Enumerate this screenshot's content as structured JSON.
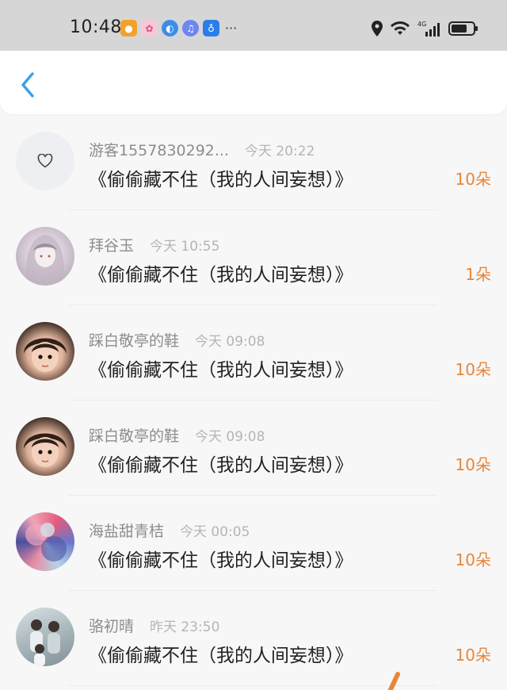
{
  "status_bar": {
    "time": "10:48",
    "more": "···",
    "notification_icons": [
      "camera-app-icon",
      "gift-app-icon",
      "browser-app-icon",
      "music-app-icon",
      "bulb-app-icon"
    ],
    "network_label": "4G"
  },
  "header": {
    "back_icon": "chevron-left-icon"
  },
  "colors": {
    "accent": "#e8863a",
    "back": "#3aa0e8",
    "name": "#8d8d8d",
    "time": "#b5b5b5"
  },
  "items": [
    {
      "name": "游客1557830292...",
      "time": "今天 20:22",
      "title": "《偷偷藏不住（我的人间妄想）》",
      "count": "10朵",
      "avatar": "heart-icon"
    },
    {
      "name": "拜谷玉",
      "time": "今天 10:55",
      "title": "《偷偷藏不住（我的人间妄想）》",
      "count": "1朵",
      "avatar": "anime-girl"
    },
    {
      "name": "踩白敬亭的鞋",
      "time": "今天 09:08",
      "title": "《偷偷藏不住（我的人间妄想）》",
      "count": "10朵",
      "avatar": "child-photo"
    },
    {
      "name": "踩白敬亭的鞋",
      "time": "今天 09:08",
      "title": "《偷偷藏不住（我的人间妄想）》",
      "count": "10朵",
      "avatar": "child-photo"
    },
    {
      "name": "海盐甜青桔",
      "time": "今天 00:05",
      "title": "《偷偷藏不住（我的人间妄想）》",
      "count": "10朵",
      "avatar": "abstract-painting"
    },
    {
      "name": "骆初晴",
      "time": "昨天 23:50",
      "title": "《偷偷藏不住（我的人间妄想）》",
      "count": "10朵",
      "avatar": "group-photo"
    }
  ]
}
